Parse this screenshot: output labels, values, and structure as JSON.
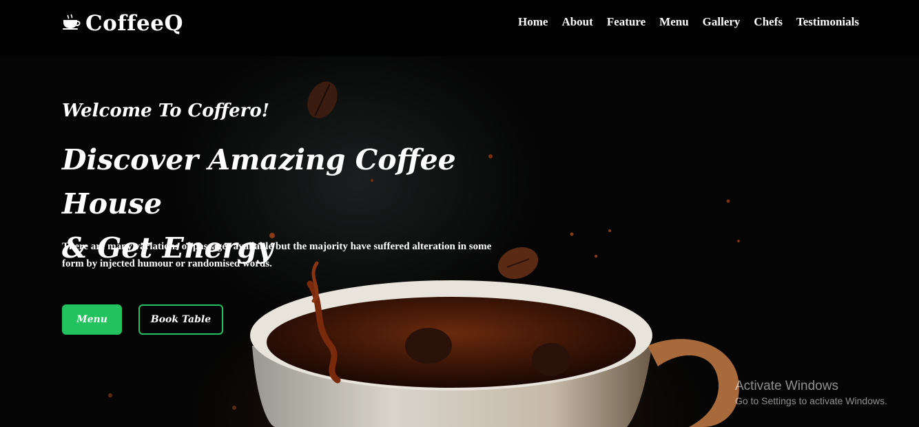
{
  "brand": {
    "name": "CoffeeQ",
    "icon": "coffee-cup-icon"
  },
  "nav": {
    "items": [
      {
        "label": "Home"
      },
      {
        "label": "About"
      },
      {
        "label": "Feature"
      },
      {
        "label": "Menu"
      },
      {
        "label": "Gallery"
      },
      {
        "label": "Chefs"
      },
      {
        "label": "Testimonials"
      }
    ]
  },
  "hero": {
    "welcome": "Welcome To Coffero!",
    "headline_line1": "Discover Amazing Coffee House",
    "headline_line2": "& Get Energy",
    "description": "There are many variations of passages available but the majority have suffered alteration in some form by injected humour or randomised words.",
    "buttons": {
      "menu_label": "Menu",
      "book_label": "Book Table"
    }
  },
  "watermark": {
    "title": "Activate Windows",
    "subtitle": "Go to Settings to activate Windows."
  },
  "colors": {
    "accent": "#22c35e",
    "background": "#000000",
    "text": "#ffffff"
  }
}
